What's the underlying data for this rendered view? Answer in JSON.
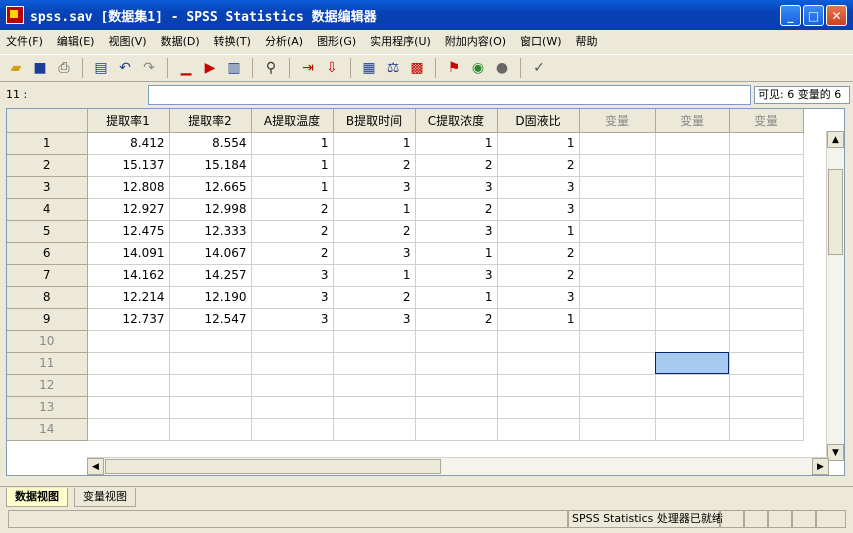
{
  "window": {
    "title": "spss.sav [数据集1] - SPSS Statistics 数据编辑器",
    "min": "_",
    "max": "□",
    "close": "✕"
  },
  "menu": [
    "文件(F)",
    "编辑(E)",
    "视图(V)",
    "数据(D)",
    "转换(T)",
    "分析(A)",
    "图形(G)",
    "实用程序(U)",
    "附加内容(O)",
    "窗口(W)",
    "帮助"
  ],
  "toolbar": {
    "icons": [
      "open-icon",
      "save-icon",
      "print-icon",
      "dialog-recall-icon",
      "undo-icon",
      "redo-icon",
      "goto-case-icon",
      "goto-variable-icon",
      "variables-icon",
      "find-icon",
      "insert-cases-icon",
      "insert-variable-icon",
      "split-file-icon",
      "weight-cases-icon",
      "select-cases-icon",
      "value-labels-icon",
      "use-sets-icon",
      "show-all-icon",
      "spell-check-icon"
    ]
  },
  "cellbar": {
    "ref": "11 :",
    "value": "",
    "visible": "可见: 6 变量的 6"
  },
  "grid": {
    "columns": [
      "提取率1",
      "提取率2",
      "A提取温度",
      "B提取时间",
      "C提取浓度",
      "D固液比",
      "变量",
      "变量",
      "变量"
    ],
    "rows": [
      {
        "n": "1",
        "cells": [
          "8.412",
          "8.554",
          "1",
          "1",
          "1",
          "1"
        ]
      },
      {
        "n": "2",
        "cells": [
          "15.137",
          "15.184",
          "1",
          "2",
          "2",
          "2"
        ]
      },
      {
        "n": "3",
        "cells": [
          "12.808",
          "12.665",
          "1",
          "3",
          "3",
          "3"
        ]
      },
      {
        "n": "4",
        "cells": [
          "12.927",
          "12.998",
          "2",
          "1",
          "2",
          "3"
        ]
      },
      {
        "n": "5",
        "cells": [
          "12.475",
          "12.333",
          "2",
          "2",
          "3",
          "1"
        ]
      },
      {
        "n": "6",
        "cells": [
          "14.091",
          "14.067",
          "2",
          "3",
          "1",
          "2"
        ]
      },
      {
        "n": "7",
        "cells": [
          "14.162",
          "14.257",
          "3",
          "1",
          "3",
          "2"
        ]
      },
      {
        "n": "8",
        "cells": [
          "12.214",
          "12.190",
          "3",
          "2",
          "1",
          "3"
        ]
      },
      {
        "n": "9",
        "cells": [
          "12.737",
          "12.547",
          "3",
          "3",
          "2",
          "1"
        ]
      },
      {
        "n": "10",
        "cells": []
      },
      {
        "n": "11",
        "cells": []
      },
      {
        "n": "12",
        "cells": []
      },
      {
        "n": "13",
        "cells": []
      },
      {
        "n": "14",
        "cells": []
      }
    ],
    "selected": {
      "row": 11,
      "col": 8
    }
  },
  "tabs": {
    "data_view": "数据视图",
    "variable_view": "变量视图"
  },
  "status": {
    "processor": "SPSS Statistics  处理器已就绪"
  },
  "colors": {
    "title_bar": "#0842b8",
    "selection": "#a6caf0",
    "active_tab": "#ffffcc"
  }
}
